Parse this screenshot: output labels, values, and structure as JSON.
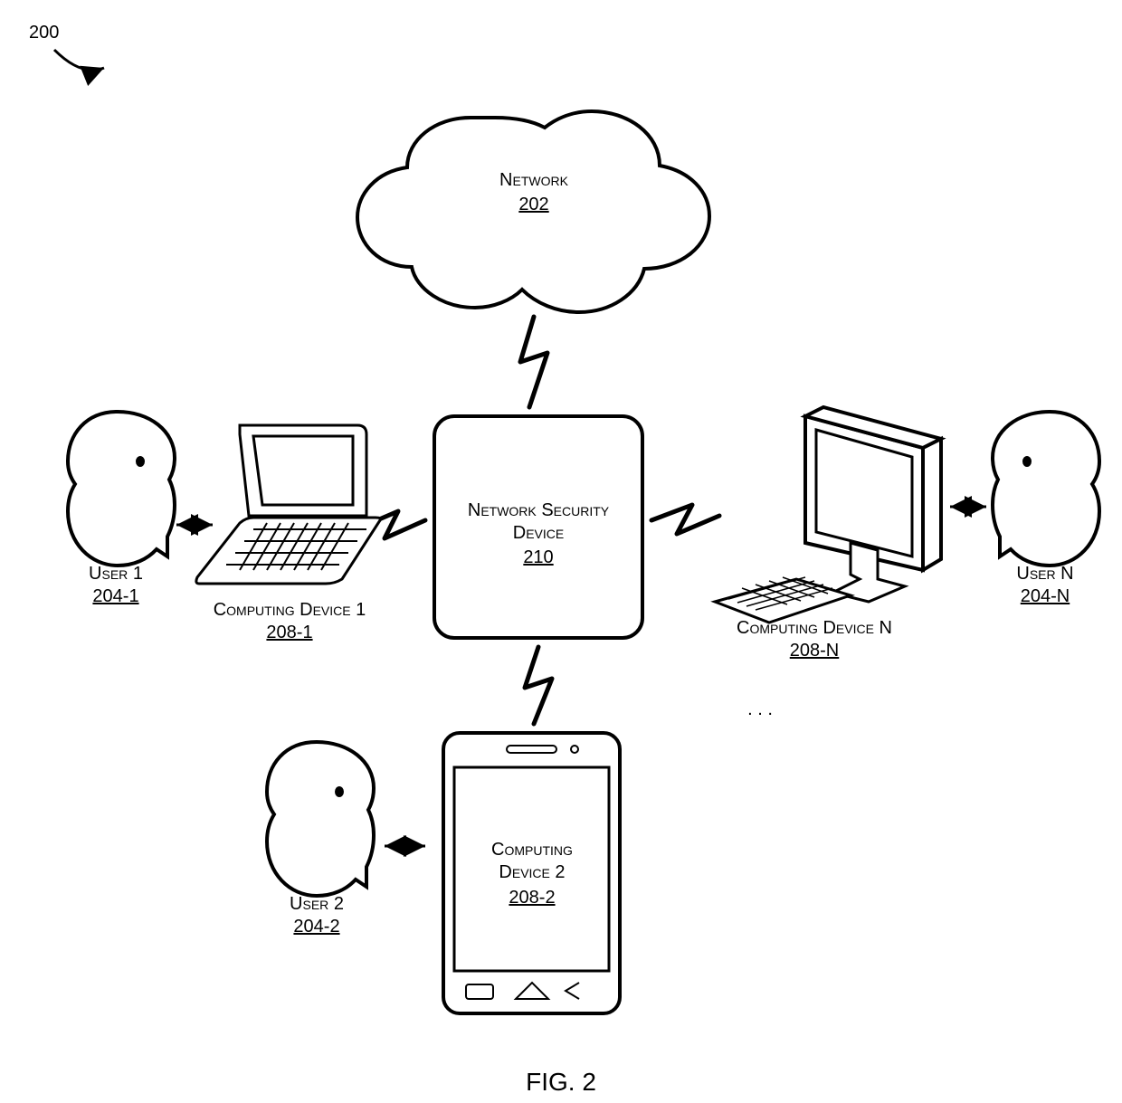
{
  "figure_ref": "200",
  "figure_caption": "FIG. 2",
  "cloud": {
    "label": "Network",
    "ref": "202"
  },
  "center_box": {
    "label1": "Network Security",
    "label2": "Device",
    "ref": "210"
  },
  "user1": {
    "label": "User 1",
    "ref": "204-1"
  },
  "user2": {
    "label": "User 2",
    "ref": "204-2"
  },
  "userN": {
    "label": "User N",
    "ref": "204-N"
  },
  "device1": {
    "label": "Computing Device 1",
    "ref": "208-1"
  },
  "device2": {
    "label1": "Computing",
    "label2": "Device 2",
    "ref": "208-2"
  },
  "deviceN": {
    "label": "Computing Device N",
    "ref": "208-N"
  },
  "ellipsis": ". . ."
}
